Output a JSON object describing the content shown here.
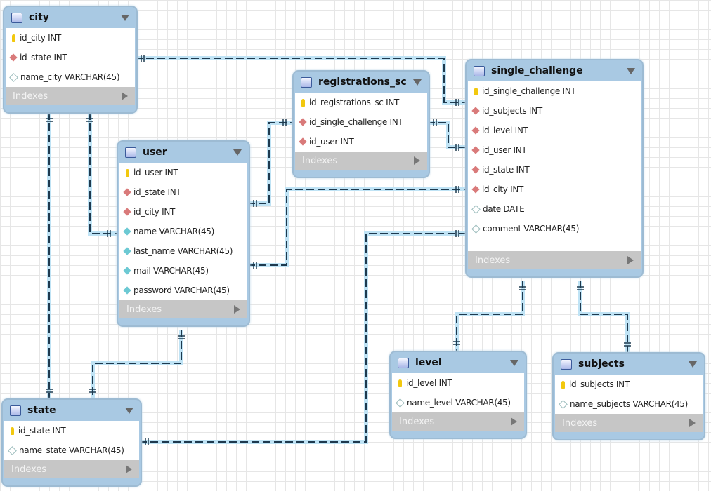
{
  "colors": {
    "header": "#a9c9e3",
    "link": "#1e3a4f",
    "glow": "#bfe3f5",
    "pk": "#f2c80e",
    "fk": "#d97a7a",
    "notnull": "#6cc9d3"
  },
  "indexes_label": "Indexes",
  "tables": [
    {
      "id": "city",
      "name": "city",
      "columns": [
        {
          "text": "id_city INT",
          "kind": "pk"
        },
        {
          "text": "id_state INT",
          "kind": "fk"
        },
        {
          "text": "name_city VARCHAR(45)",
          "kind": "nullable"
        }
      ]
    },
    {
      "id": "registrations_sc",
      "name": "registrations_sc",
      "columns": [
        {
          "text": "id_registrations_sc INT",
          "kind": "pk"
        },
        {
          "text": "id_single_challenge INT",
          "kind": "fk"
        },
        {
          "text": "id_user INT",
          "kind": "fk"
        }
      ]
    },
    {
      "id": "single_challenge",
      "name": "single_challenge",
      "columns": [
        {
          "text": "id_single_challenge INT",
          "kind": "pk"
        },
        {
          "text": "id_subjects INT",
          "kind": "fk"
        },
        {
          "text": "id_level INT",
          "kind": "fk"
        },
        {
          "text": "id_user INT",
          "kind": "fk"
        },
        {
          "text": "id_state INT",
          "kind": "fk"
        },
        {
          "text": "id_city INT",
          "kind": "fk"
        },
        {
          "text": "date DATE",
          "kind": "nullable"
        },
        {
          "text": "comment VARCHAR(45)",
          "kind": "nullable"
        }
      ]
    },
    {
      "id": "user",
      "name": "user",
      "columns": [
        {
          "text": "id_user INT",
          "kind": "pk"
        },
        {
          "text": "id_state INT",
          "kind": "fk"
        },
        {
          "text": "id_city INT",
          "kind": "fk"
        },
        {
          "text": "name VARCHAR(45)",
          "kind": "notnull"
        },
        {
          "text": "last_name VARCHAR(45)",
          "kind": "notnull"
        },
        {
          "text": "mail VARCHAR(45)",
          "kind": "notnull"
        },
        {
          "text": "password VARCHAR(45)",
          "kind": "notnull"
        }
      ]
    },
    {
      "id": "state",
      "name": "state",
      "columns": [
        {
          "text": "id_state INT",
          "kind": "pk"
        },
        {
          "text": "name_state VARCHAR(45)",
          "kind": "nullable"
        }
      ]
    },
    {
      "id": "level",
      "name": "level",
      "columns": [
        {
          "text": "id_level INT",
          "kind": "pk"
        },
        {
          "text": "name_level VARCHAR(45)",
          "kind": "nullable"
        }
      ]
    },
    {
      "id": "subjects",
      "name": "subjects",
      "columns": [
        {
          "text": "id_subjects INT",
          "kind": "pk"
        },
        {
          "text": "name_subjects VARCHAR(45)",
          "kind": "nullable"
        }
      ]
    }
  ],
  "relationships": [
    {
      "from": "city",
      "to": "single_challenge"
    },
    {
      "from": "state",
      "to": "city"
    },
    {
      "from": "city",
      "to": "user"
    },
    {
      "from": "user",
      "to": "registrations_sc"
    },
    {
      "from": "single_challenge",
      "to": "registrations_sc"
    },
    {
      "from": "user",
      "to": "single_challenge"
    },
    {
      "from": "state",
      "to": "single_challenge"
    },
    {
      "from": "state",
      "to": "user"
    },
    {
      "from": "level",
      "to": "single_challenge"
    },
    {
      "from": "subjects",
      "to": "single_challenge"
    }
  ]
}
